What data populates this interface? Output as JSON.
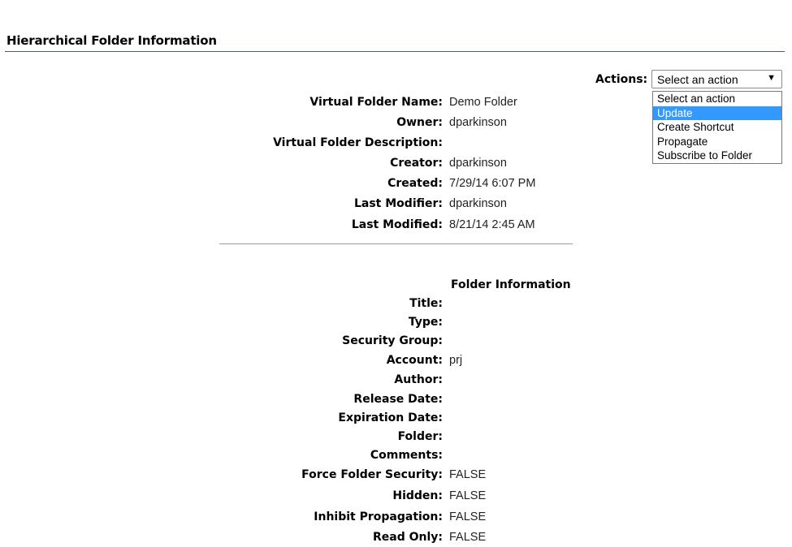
{
  "page": {
    "title": "Hierarchical Folder Information"
  },
  "actions": {
    "label": "Actions:",
    "selected": "Select an action",
    "arrow": "▼",
    "options": [
      "Select an action",
      "Update",
      "Create Shortcut",
      "Propagate",
      "Subscribe to Folder"
    ],
    "highlighted": "Update"
  },
  "virtual_folder": [
    {
      "label": "Virtual Folder Name:",
      "value": "Demo Folder"
    },
    {
      "label": "Owner:",
      "value": "dparkinson"
    },
    {
      "label": "Virtual Folder Description:",
      "value": ""
    },
    {
      "label": "Creator:",
      "value": "dparkinson"
    },
    {
      "label": "Created:",
      "value": "7/29/14 6:07 PM"
    },
    {
      "label": "Last Modifier:",
      "value": "dparkinson"
    },
    {
      "label": "Last Modified:",
      "value": "8/21/14 2:45 AM"
    }
  ],
  "folder_info": {
    "header": "Folder Information",
    "fields": [
      {
        "label": "Title:",
        "value": ""
      },
      {
        "label": "Type:",
        "value": ""
      },
      {
        "label": "Security Group:",
        "value": ""
      },
      {
        "label": "Account:",
        "value": "prj"
      },
      {
        "label": "Author:",
        "value": ""
      },
      {
        "label": "Release Date:",
        "value": ""
      },
      {
        "label": "Expiration Date:",
        "value": ""
      },
      {
        "label": "Folder:",
        "value": ""
      },
      {
        "label": "Comments:",
        "value": ""
      },
      {
        "label": "Force Folder Security:",
        "value": "FALSE"
      },
      {
        "label": "Hidden:",
        "value": "FALSE"
      },
      {
        "label": "Inhibit Propagation:",
        "value": "FALSE"
      },
      {
        "label": "Read Only:",
        "value": "FALSE"
      }
    ]
  }
}
